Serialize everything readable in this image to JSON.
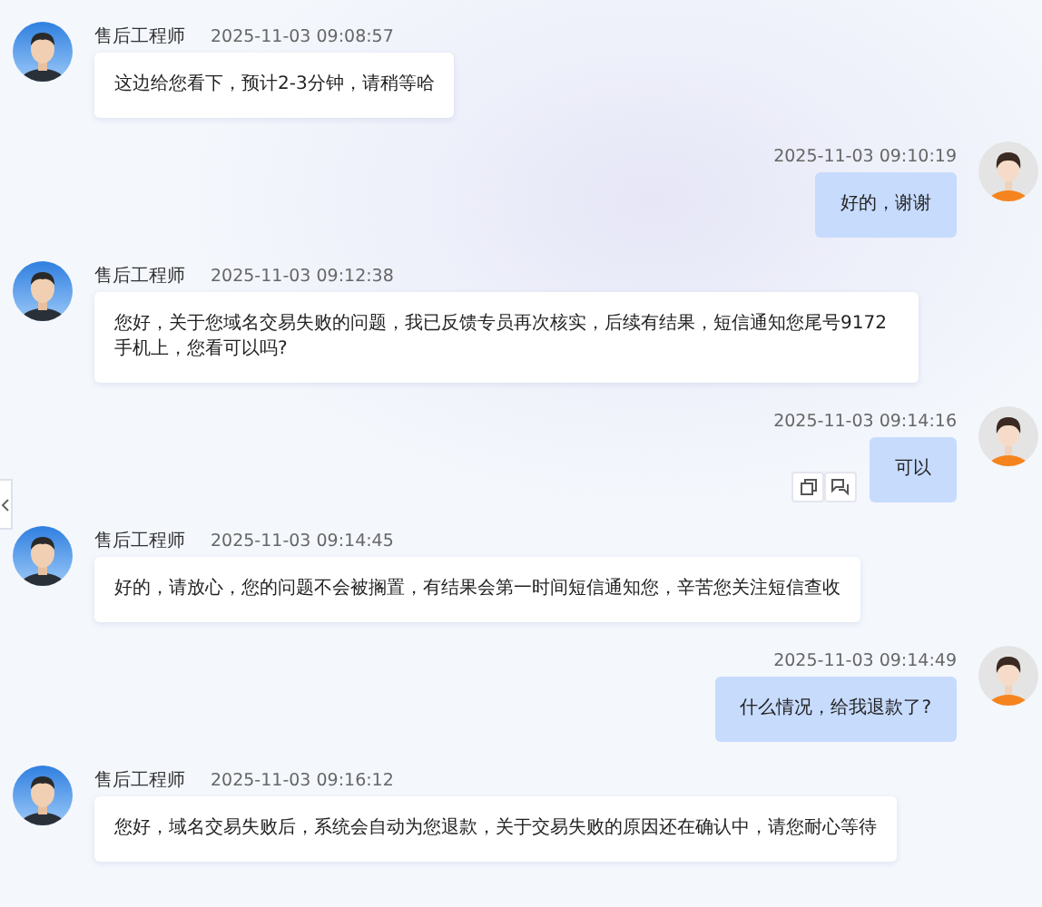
{
  "messages": [
    {
      "kind": "agent",
      "name": "售后工程师",
      "time": "2025-11-03 09:08:57",
      "text": "这边给您看下，预计2-3分钟，请稍等哈",
      "show_actions": false
    },
    {
      "kind": "user",
      "time": "2025-11-03 09:10:19",
      "text": "好的，谢谢",
      "show_actions": false
    },
    {
      "kind": "agent",
      "name": "售后工程师",
      "time": "2025-11-03 09:12:38",
      "text": "您好，关于您域名交易失败的问题，我已反馈专员再次核实，后续有结果，短信通知您尾号9172手机上，您看可以吗?",
      "show_actions": false
    },
    {
      "kind": "user",
      "time": "2025-11-03 09:14:16",
      "text": "可以",
      "show_actions": true
    },
    {
      "kind": "agent",
      "name": "售后工程师",
      "time": "2025-11-03 09:14:45",
      "text": "好的，请放心，您的问题不会被搁置，有结果会第一时间短信通知您，辛苦您关注短信查收",
      "show_actions": false
    },
    {
      "kind": "user",
      "time": "2025-11-03 09:14:49",
      "text": "什么情况，给我退款了?",
      "show_actions": false
    },
    {
      "kind": "agent",
      "name": "售后工程师",
      "time": "2025-11-03 09:16:12",
      "text": "您好，域名交易失败后，系统会自动为您退款，关于交易失败的原因还在确认中，请您耐心等待",
      "show_actions": false
    }
  ]
}
